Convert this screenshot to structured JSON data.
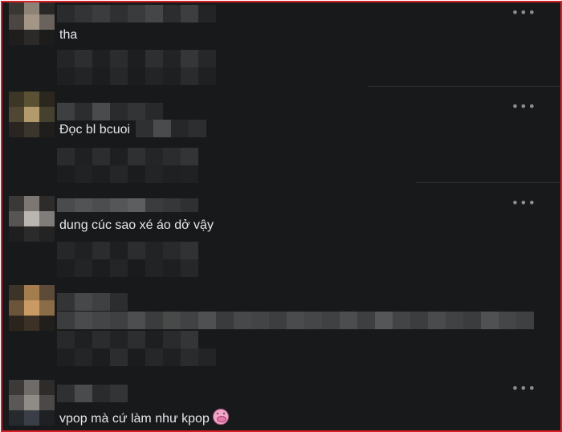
{
  "comments": [
    {
      "text": "tha",
      "more_label": "•••"
    },
    {
      "text": "Đọc bl bcuoi",
      "more_label": "•••"
    },
    {
      "text": "dung cúc sao xé áo dở vậy",
      "more_label": "•••"
    },
    {
      "text": ""
    },
    {
      "text": "vpop mà cứ làm như kpop",
      "more_label": "•••",
      "emoji": "pig-face-emoji"
    }
  ],
  "colors": {
    "frame_border": "#d61f26",
    "background": "#18191a",
    "text": "#e4e6eb",
    "icon": "#8a8d91"
  }
}
